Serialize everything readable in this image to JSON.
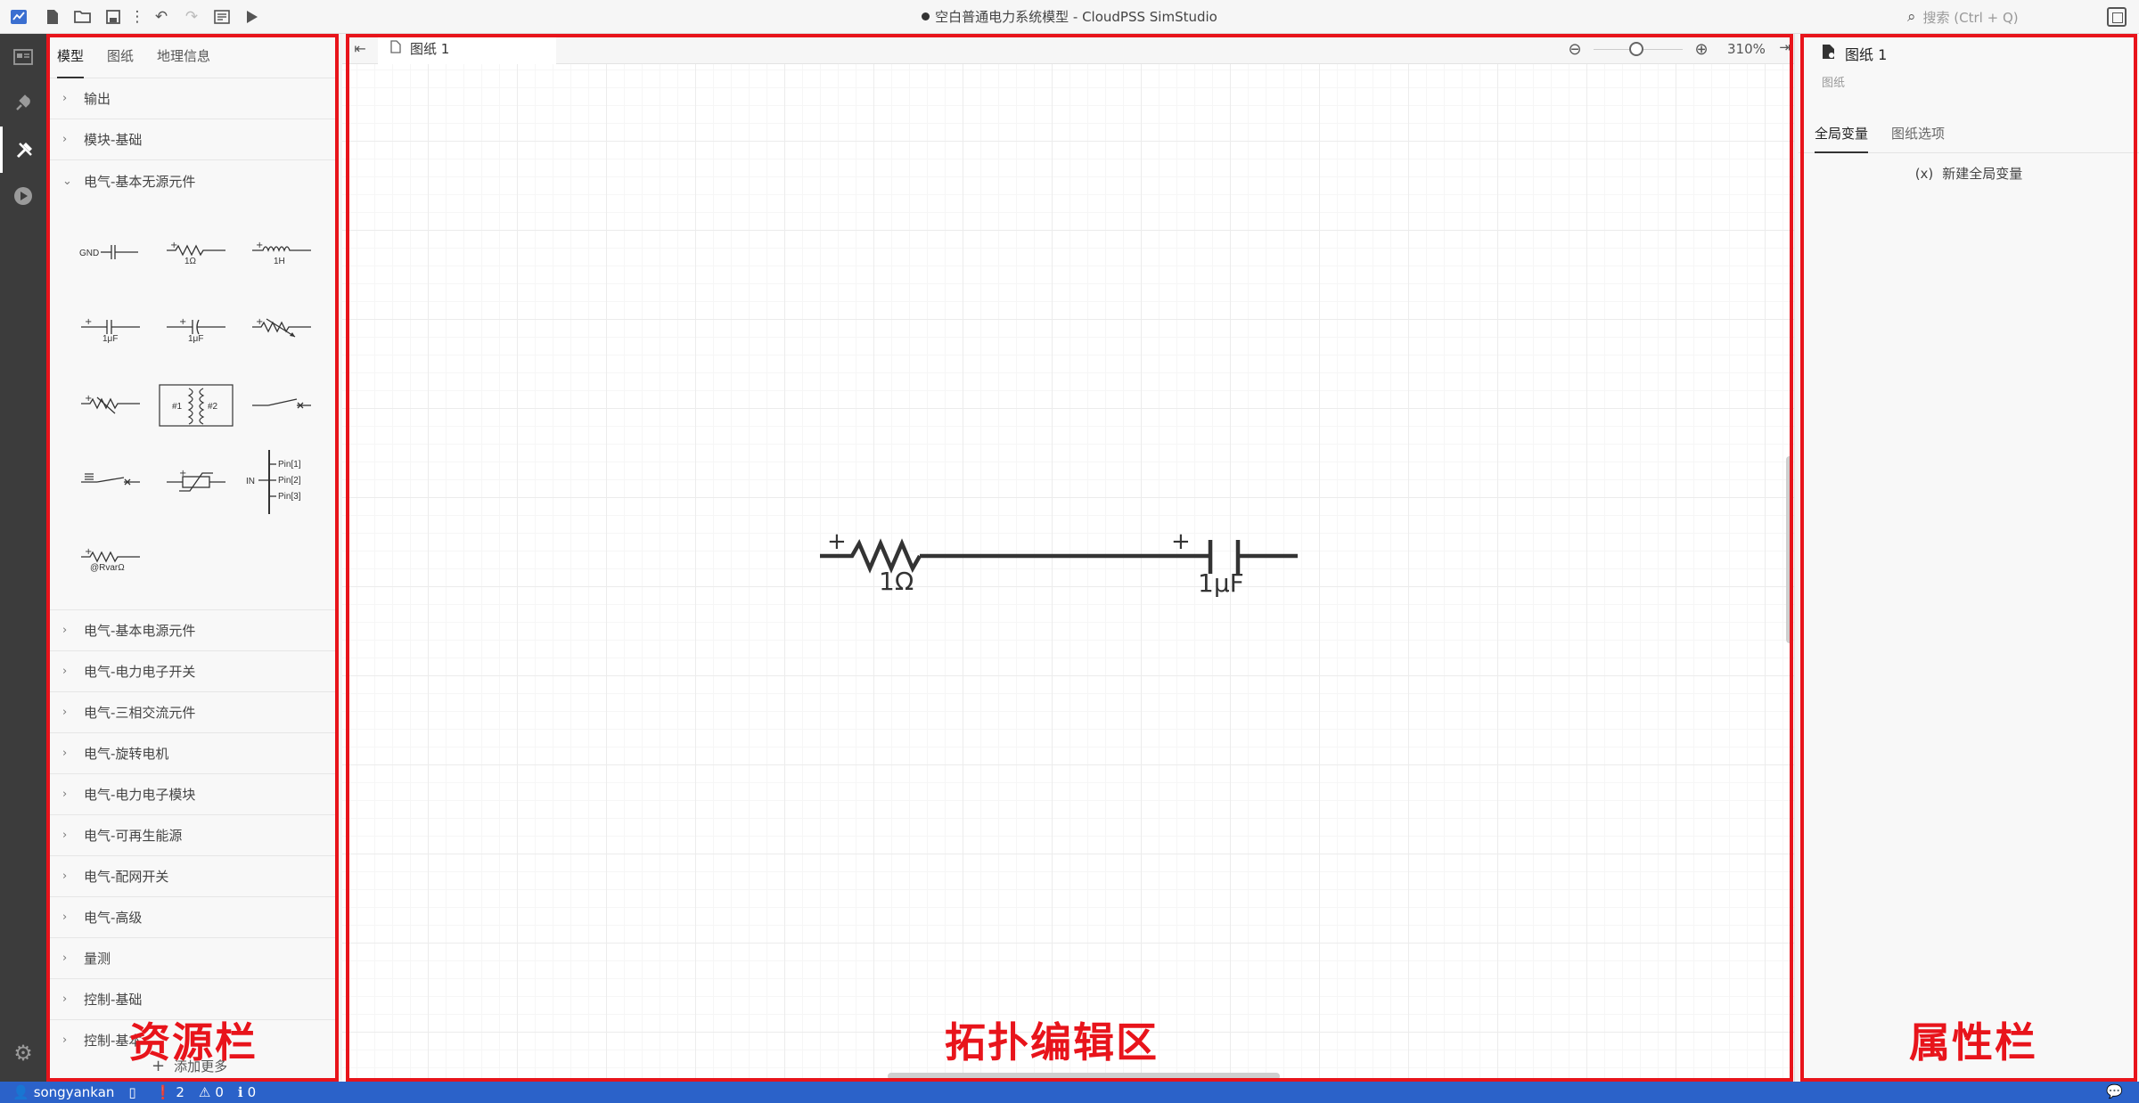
{
  "window": {
    "title": "空白普通电力系统模型 - CloudPSS SimStudio",
    "search_placeholder": "搜索 (Ctrl + Q)"
  },
  "resource_panel": {
    "tabs": [
      "模型",
      "图纸",
      "地理信息"
    ],
    "categories_top": [
      "输出",
      "模块-基础",
      "电气-基本无源元件"
    ],
    "components": [
      {
        "icon": "ground-icon",
        "label": "GND"
      },
      {
        "icon": "resistor-icon",
        "label": "1Ω"
      },
      {
        "icon": "inductor-icon",
        "label": "1H"
      },
      {
        "icon": "capacitor-icon",
        "label": "1μF"
      },
      {
        "icon": "capacitor-icon",
        "label": "1μF"
      },
      {
        "icon": "variable-resistor-icon",
        "label": ""
      },
      {
        "icon": "variable-resistor-icon",
        "label": ""
      },
      {
        "icon": "transformer-icon",
        "label": "#1 #2"
      },
      {
        "icon": "switch-icon",
        "label": ""
      },
      {
        "icon": "breaker-icon",
        "label": ""
      },
      {
        "icon": "surge-arrester-icon",
        "label": ""
      },
      {
        "icon": "bus-pin-icon",
        "label": "IN Pin[1] Pin[2] Pin[3]"
      },
      {
        "icon": "resistor-icon",
        "label": "@RvarΩ"
      }
    ],
    "categories_bottom": [
      "电气-基本电源元件",
      "电气-电力电子开关",
      "电气-三相交流元件",
      "电气-旋转电机",
      "电气-电力电子模块",
      "电气-可再生能源",
      "电气-配网开关",
      "电气-高级",
      "量测",
      "控制-基础",
      "控制-基本"
    ],
    "add_more": "添加更多"
  },
  "editor": {
    "tab_label": "图纸 1",
    "zoom": "310%",
    "circuit": {
      "resistor_label": "1Ω",
      "capacitor_label": "1μF",
      "plus_sign": "+"
    }
  },
  "properties": {
    "title": "图纸 1",
    "subtitle": "图纸",
    "tabs": [
      "全局变量",
      "图纸选项"
    ],
    "new_var": "新建全局变量",
    "new_var_icon": "(x)"
  },
  "annotations": {
    "resource": "资源栏",
    "editor": "拓扑编辑区",
    "properties": "属性栏",
    "color": "#e8141b"
  },
  "status": {
    "user": "songyankan",
    "errors": "2",
    "warnings": "0",
    "infos": "0"
  }
}
